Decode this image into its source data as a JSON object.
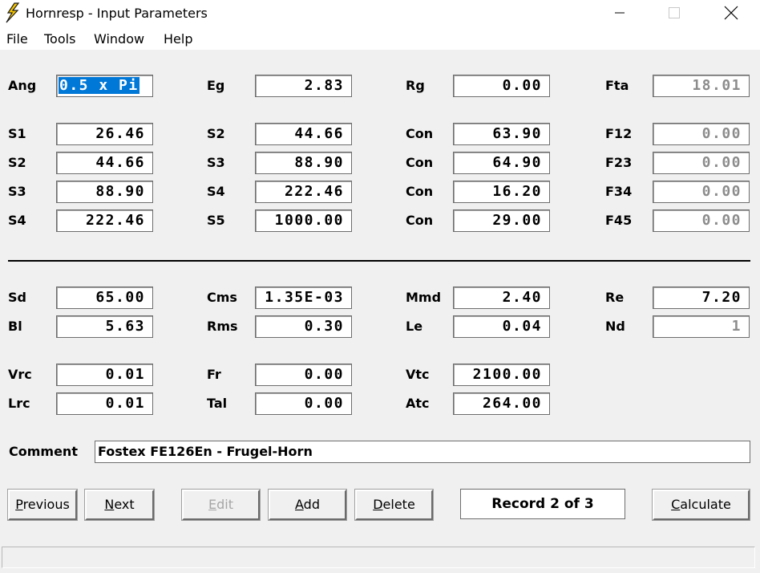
{
  "window": {
    "title": "Hornresp - Input Parameters",
    "icon": "lightning-bolt-icon",
    "controls": {
      "minimize": "minimize-icon",
      "maximize": "maximize-icon",
      "close": "close-icon"
    }
  },
  "menu": [
    "File",
    "Tools",
    "Window",
    "Help"
  ],
  "horn": [
    [
      {
        "label": "Ang",
        "value": "0.5 x Pi",
        "selected": true
      },
      {
        "label": "Eg",
        "value": "2.83"
      },
      {
        "label": "Rg",
        "value": "0.00"
      },
      {
        "label": "Fta",
        "value": "18.01",
        "readonly": true
      }
    ],
    [
      {
        "label": "S1",
        "value": "26.46"
      },
      {
        "label": "S2",
        "value": "44.66"
      },
      {
        "label": "Con",
        "value": "63.90"
      },
      {
        "label": "F12",
        "value": "0.00",
        "readonly": true
      }
    ],
    [
      {
        "label": "S2",
        "value": "44.66"
      },
      {
        "label": "S3",
        "value": "88.90"
      },
      {
        "label": "Con",
        "value": "64.90"
      },
      {
        "label": "F23",
        "value": "0.00",
        "readonly": true
      }
    ],
    [
      {
        "label": "S3",
        "value": "88.90"
      },
      {
        "label": "S4",
        "value": "222.46"
      },
      {
        "label": "Con",
        "value": "16.20"
      },
      {
        "label": "F34",
        "value": "0.00",
        "readonly": true
      }
    ],
    [
      {
        "label": "S4",
        "value": "222.46"
      },
      {
        "label": "S5",
        "value": "1000.00"
      },
      {
        "label": "Con",
        "value": "29.00"
      },
      {
        "label": "F45",
        "value": "0.00",
        "readonly": true
      }
    ]
  ],
  "driver": [
    [
      {
        "label": "Sd",
        "value": "65.00"
      },
      {
        "label": "Cms",
        "value": "1.35E-03"
      },
      {
        "label": "Mmd",
        "value": "2.40"
      },
      {
        "label": "Re",
        "value": "7.20"
      }
    ],
    [
      {
        "label": "Bl",
        "value": "5.63"
      },
      {
        "label": "Rms",
        "value": "0.30"
      },
      {
        "label": "Le",
        "value": "0.04"
      },
      {
        "label": "Nd",
        "value": "1",
        "readonly": true
      }
    ]
  ],
  "chamber": [
    [
      {
        "label": "Vrc",
        "value": "0.01"
      },
      {
        "label": "Fr",
        "value": "0.00"
      },
      {
        "label": "Vtc",
        "value": "2100.00"
      }
    ],
    [
      {
        "label": "Lrc",
        "value": "0.01"
      },
      {
        "label": "Tal",
        "value": "0.00"
      },
      {
        "label": "Atc",
        "value": "264.00"
      }
    ]
  ],
  "comment": {
    "label": "Comment",
    "value": "Fostex FE126En - Frugel-Horn"
  },
  "buttons": {
    "previous": {
      "mnemonic": "P",
      "rest": "revious"
    },
    "next": {
      "mnemonic": "N",
      "rest": "ext"
    },
    "edit": {
      "mnemonic": "E",
      "rest": "dit",
      "disabled": true
    },
    "add": {
      "mnemonic": "A",
      "rest": "dd"
    },
    "delete": {
      "mnemonic": "D",
      "rest": "elete"
    },
    "calculate": {
      "mnemonic": "C",
      "rest": "alculate"
    }
  },
  "record": "Record 2 of 3",
  "colors": {
    "selection": "#0078d7",
    "background": "#f0f0f0",
    "readonly_text": "#8c8c8c",
    "icon_bolt": "#f5c400"
  }
}
